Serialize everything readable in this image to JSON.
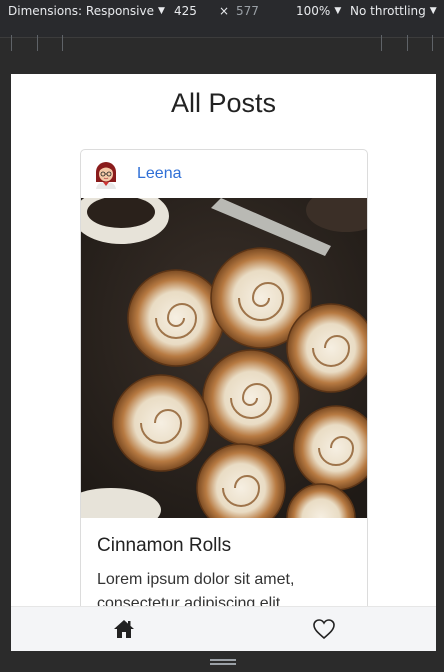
{
  "devtools": {
    "dimensions_label": "Dimensions: Responsive",
    "width_value": "425",
    "times_symbol": "×",
    "height_value": "577",
    "zoom_label": "100%",
    "throttling_label": "No throttling"
  },
  "page": {
    "title": "All Posts"
  },
  "post": {
    "author": "Leena",
    "title": "Cinnamon Rolls",
    "body": "Lorem ipsum dolor sit amet, consectetur adipiscing elit.",
    "image_subject": "cinnamon rolls with white icing"
  },
  "nav": {
    "home_icon": "home-icon",
    "favorites_icon": "heart-icon"
  },
  "colors": {
    "author_link": "#2f6fd6",
    "devtools_bg": "#292a2d",
    "page_bg": "#ffffff"
  }
}
